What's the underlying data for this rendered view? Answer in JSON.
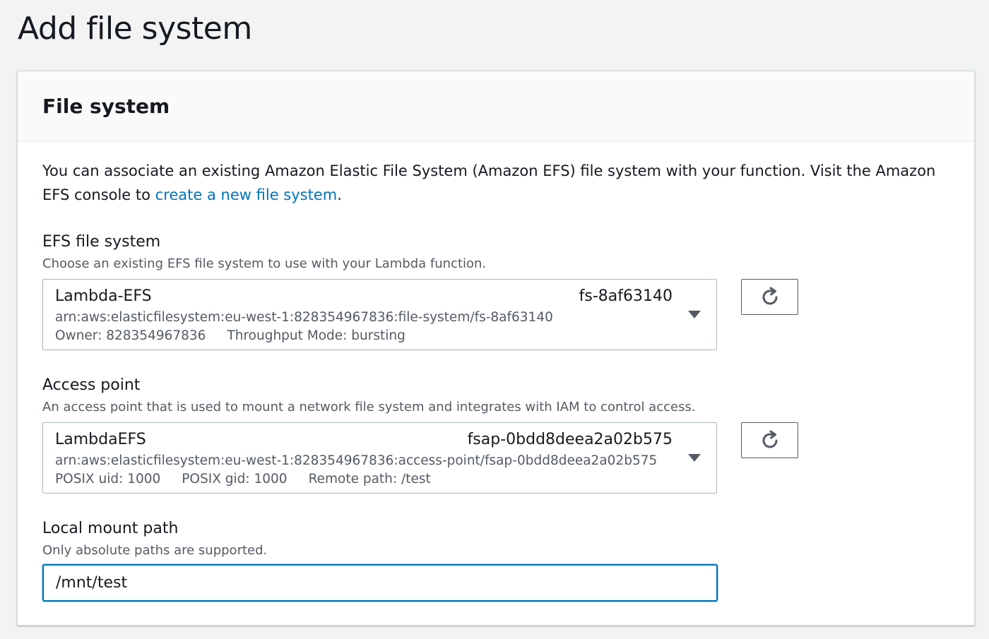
{
  "page": {
    "title": "Add file system"
  },
  "panel": {
    "title": "File system",
    "intro_text": "You can associate an existing Amazon Elastic File System (Amazon EFS) file system with your function. Visit the Amazon EFS console to ",
    "intro_link": "create a new file system",
    "intro_end": "."
  },
  "efs": {
    "label": "EFS file system",
    "description": "Choose an existing EFS file system to use with your Lambda function.",
    "selected": {
      "name": "Lambda-EFS",
      "id": "fs-8af63140",
      "arn": "arn:aws:elasticfilesystem:eu-west-1:828354967836:file-system/fs-8af63140",
      "owner": "Owner: 828354967836",
      "throughput": "Throughput Mode: bursting"
    },
    "refresh_icon": "refresh-icon"
  },
  "access_point": {
    "label": "Access point",
    "description": "An access point that is used to mount a network file system and integrates with IAM to control access.",
    "selected": {
      "name": "LambdaEFS",
      "id": "fsap-0bdd8deea2a02b575",
      "arn": "arn:aws:elasticfilesystem:eu-west-1:828354967836:access-point/fsap-0bdd8deea2a02b575",
      "uid": "POSIX uid: 1000",
      "gid": "POSIX gid: 1000",
      "remote_path": "Remote path: /test"
    },
    "refresh_icon": "refresh-icon"
  },
  "mount_path": {
    "label": "Local mount path",
    "description": "Only absolute paths are supported.",
    "value": "/mnt/test"
  },
  "colors": {
    "link": "#0073bb",
    "focus": "#0073bb",
    "text": "#16191f",
    "secondary": "#545b64"
  }
}
